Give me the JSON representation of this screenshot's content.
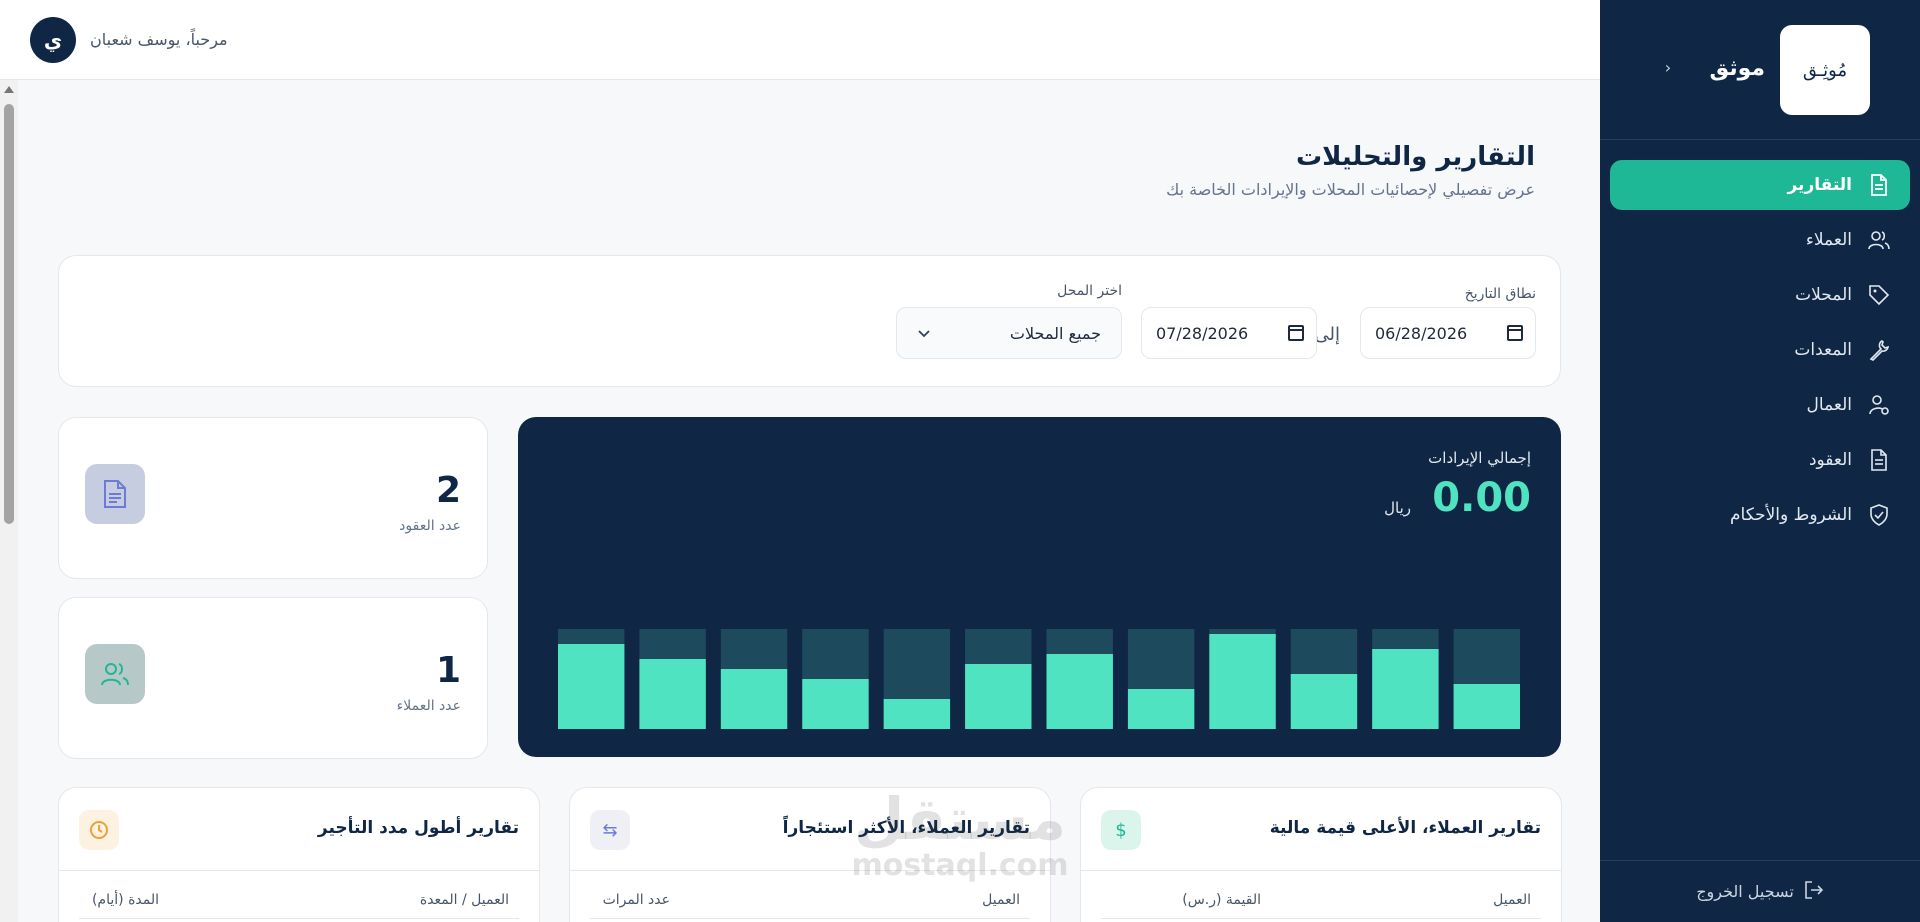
{
  "sidebar": {
    "brand": "موثق",
    "logo_text": "مُوثِـق",
    "collapse_icon": "chevron-right-icon",
    "items": [
      {
        "label": "التقارير",
        "icon": "file-icon",
        "active": true
      },
      {
        "label": "العملاء",
        "icon": "users-icon",
        "active": false
      },
      {
        "label": "المحلات",
        "icon": "tag-icon",
        "active": false
      },
      {
        "label": "المعدات",
        "icon": "wrench-icon",
        "active": false
      },
      {
        "label": "العمال",
        "icon": "user-cog-icon",
        "active": false
      },
      {
        "label": "العقود",
        "icon": "document-icon",
        "active": false
      },
      {
        "label": "الشروط والأحكام",
        "icon": "shield-check-icon",
        "active": false
      }
    ],
    "logout_label": "تسجيل الخروج"
  },
  "topbar": {
    "greeting": "مرحباً، يوسف شعبان",
    "avatar_initial": "ي"
  },
  "page": {
    "title": "التقارير والتحليلات",
    "subtitle": "عرض تفصيلي لإحصائيات المحلات والإيرادات الخاصة بك"
  },
  "filters": {
    "date_range_label": "نطاق التاريخ",
    "date_from": "06/28/2026",
    "to_label": "إلى",
    "date_to": "07/28/2026",
    "shop_label": "اختر المحل",
    "shop_value": "جميع المحلات"
  },
  "revenue": {
    "label": "إجمالي الإيرادات",
    "value": "0.00",
    "unit": "ريال"
  },
  "stats": {
    "contracts": {
      "value": "2",
      "label": "عدد العقود"
    },
    "customers": {
      "value": "1",
      "label": "عدد العملاء"
    }
  },
  "reports": {
    "top_value": {
      "title": "تقارير العملاء، الأعلى قيمة مالية",
      "col1": "العميل",
      "col2": "القيمة (ر.س)"
    },
    "most_rentals": {
      "title": "تقارير العملاء، الأكثر استئجاراً",
      "col1": "العميل",
      "col2": "عدد المرات"
    },
    "longest": {
      "title": "تقارير أطول مدد التأجير",
      "col1": "العميل / المعدة",
      "col2": "المدة (أيام)"
    }
  },
  "watermark": {
    "line1": "مستقل",
    "line2": "mostaql.com"
  },
  "chart_data": {
    "type": "bar",
    "categories": [
      "",
      "",
      "",
      "",
      "",
      "",
      "",
      "",
      "",
      "",
      "",
      ""
    ],
    "values": [
      0.85,
      0.7,
      0.6,
      0.5,
      0.3,
      0.65,
      0.75,
      0.4,
      0.95,
      0.55,
      0.8,
      0.45
    ],
    "background_values": [
      1,
      1,
      1,
      1,
      1,
      1,
      1,
      1,
      1,
      1,
      1,
      1
    ],
    "colors": {
      "bar": "#4fe3c1",
      "track": "#1e4a5e"
    }
  }
}
